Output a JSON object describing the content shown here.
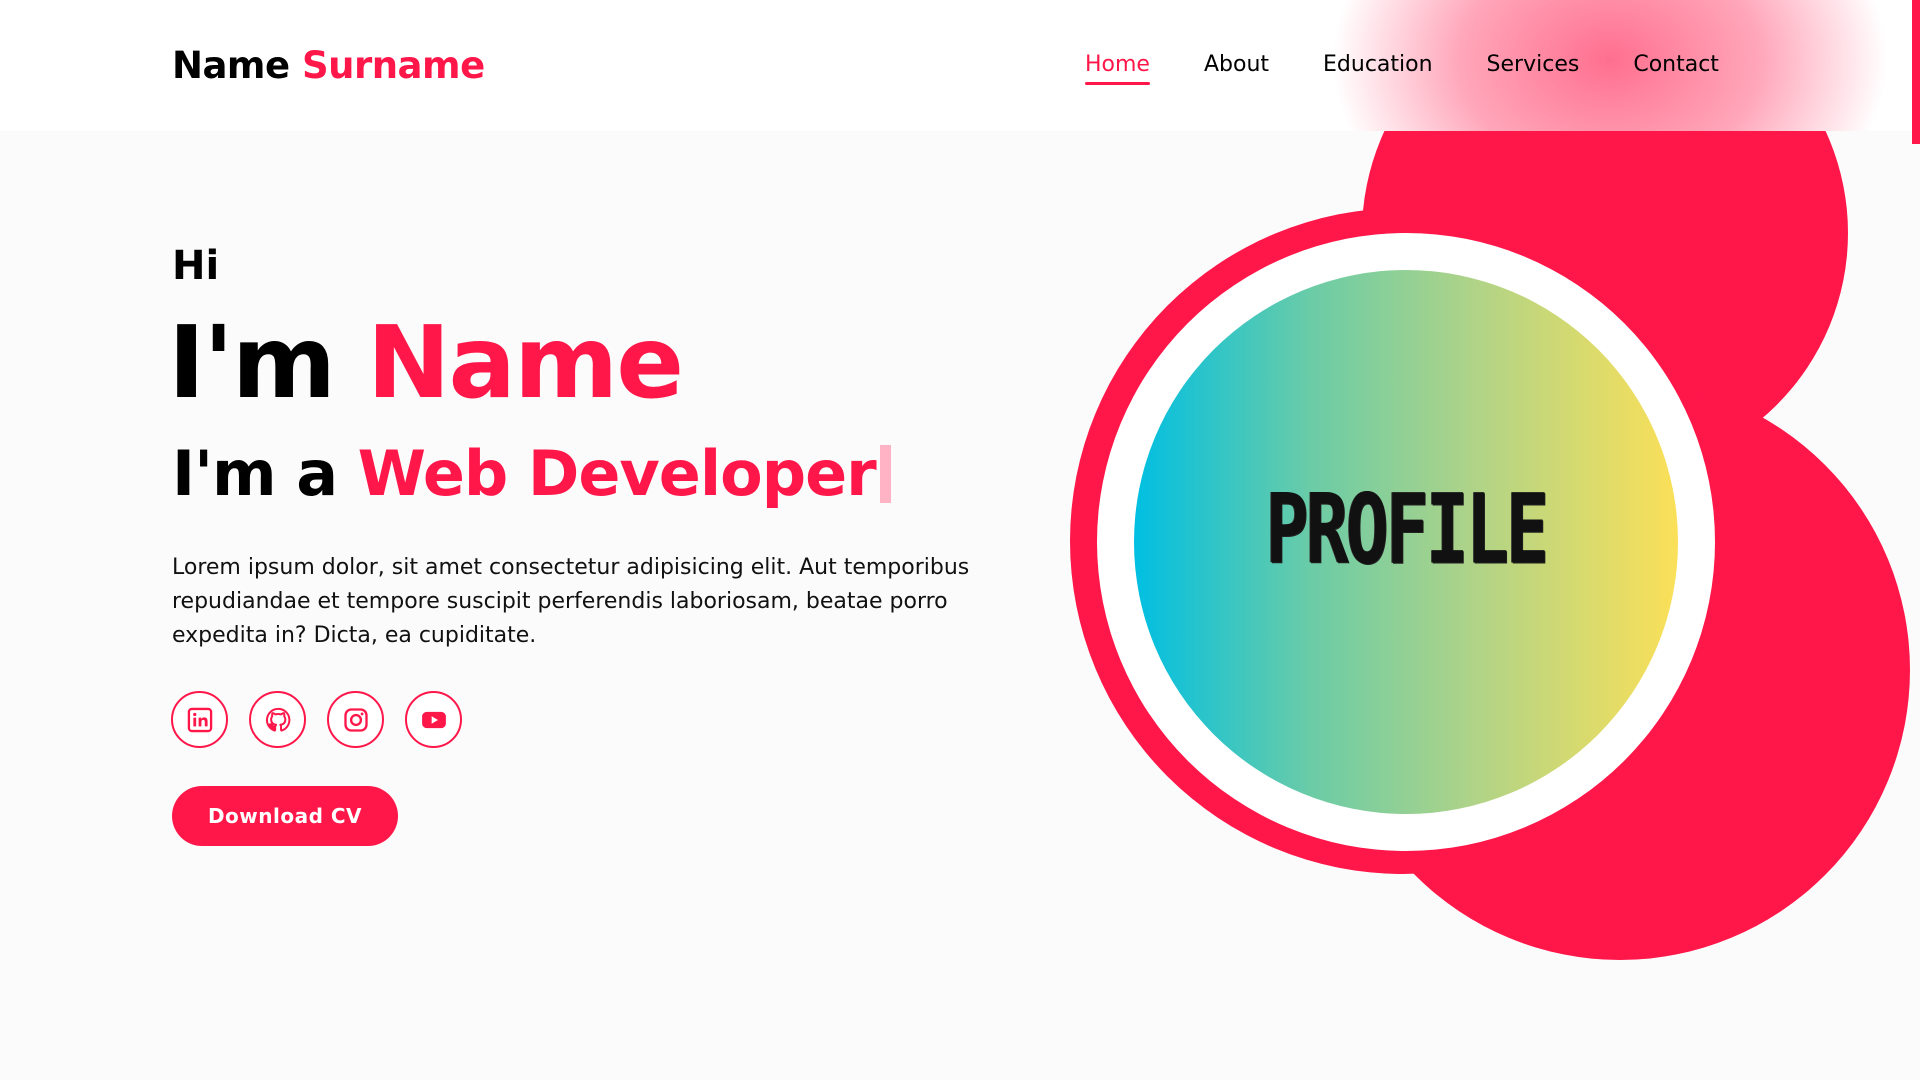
{
  "header": {
    "logo_first": "Name",
    "logo_second": "Surname",
    "nav": [
      "Home",
      "About",
      "Education",
      "Services",
      "Contact"
    ],
    "active_nav": "Home"
  },
  "hero": {
    "greeting": "Hi",
    "intro_prefix": "I'm",
    "intro_name": "Name",
    "role_prefix": "I'm a",
    "role": "Web Developer",
    "description": "Lorem ipsum dolor, sit amet consectetur adipisicing elit. Aut temporibus repudiandae et tempore suscipit perferendis laboriosam, beatae porro expedita in? Dicta, ea cupiditate.",
    "socials": [
      "linkedin-icon",
      "github-icon",
      "instagram-icon",
      "youtube-icon"
    ],
    "cv_button": "Download CV",
    "profile_text": "PROFILE"
  },
  "colors": {
    "accent": "#ff174a",
    "background": "#fbfbfc",
    "gradient": [
      "#00bfe2",
      "#fbe058"
    ]
  }
}
